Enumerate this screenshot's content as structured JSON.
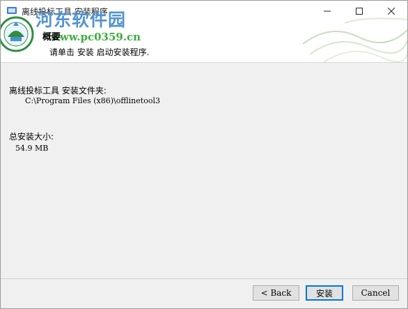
{
  "window": {
    "title": "离线投标工具 安装程序"
  },
  "watermark": {
    "site_name": "河东软件园",
    "url": "www.pc0359.cn"
  },
  "header": {
    "section_title": "概要",
    "section_subtitle": "请单击 安装 启动安装程序."
  },
  "content": {
    "install_folder_label": "离线投标工具 安装文件夹:",
    "install_folder_path": "C:\\Program Files (x86)\\offlinetool3",
    "total_size_label": "总安装大小:",
    "total_size_value": "54.9 MB"
  },
  "buttons": {
    "back": "< Back",
    "install": "安装",
    "cancel": "Cancel"
  },
  "colors": {
    "watermark_blue": "#4a8fd0",
    "watermark_green": "#3cae3c",
    "default_button_border": "#0078d7"
  }
}
